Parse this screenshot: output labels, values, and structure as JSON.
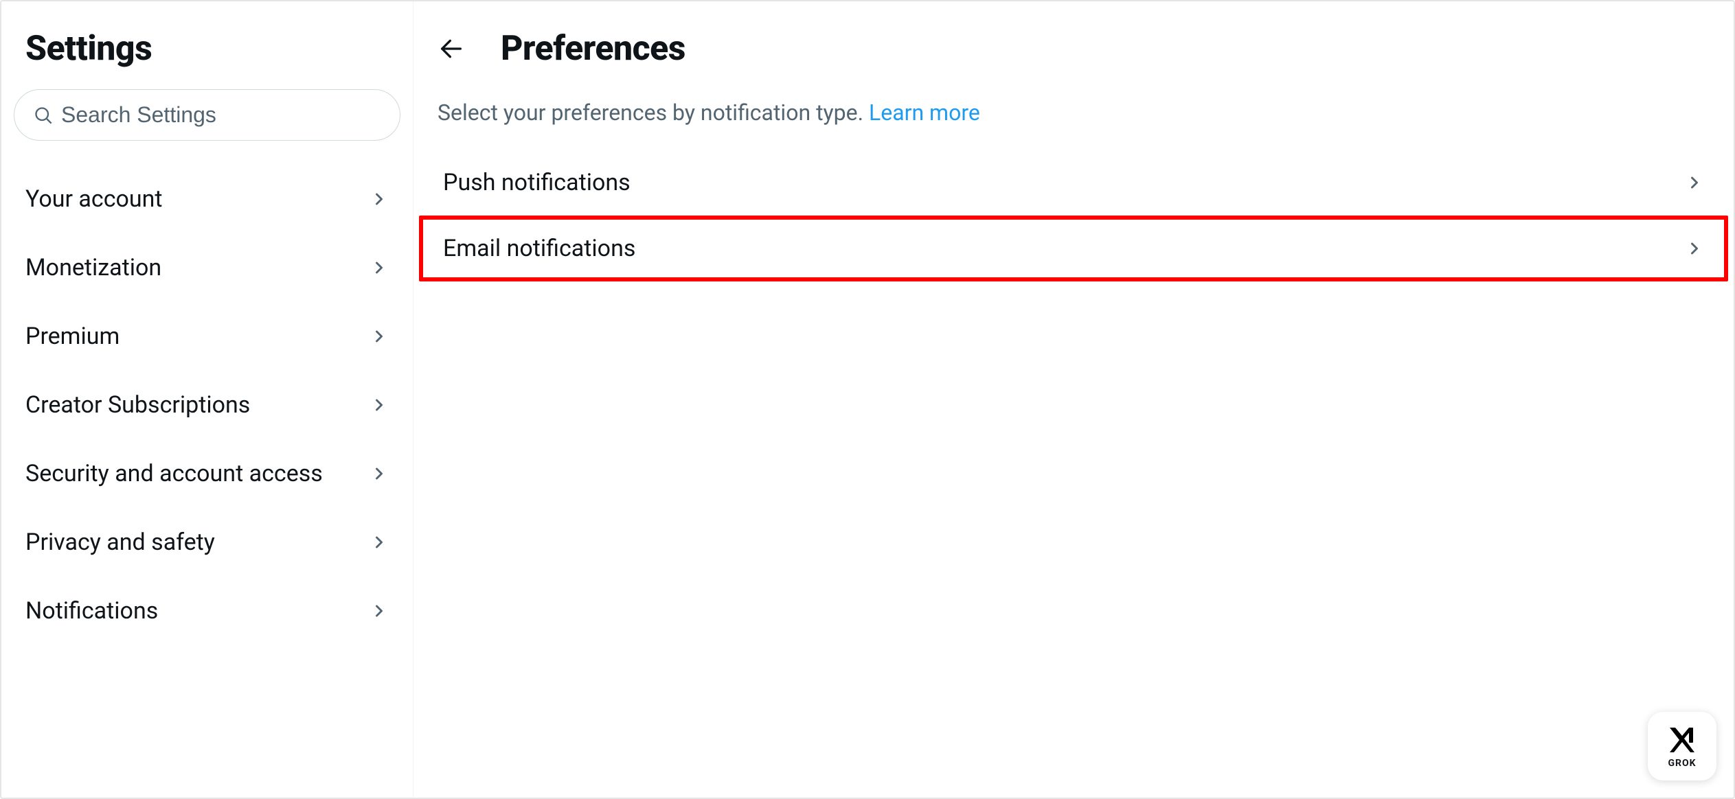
{
  "sidebar": {
    "title": "Settings",
    "search_placeholder": "Search Settings",
    "items": [
      {
        "label": "Your account"
      },
      {
        "label": "Monetization"
      },
      {
        "label": "Premium"
      },
      {
        "label": "Creator Subscriptions"
      },
      {
        "label": "Security and account access"
      },
      {
        "label": "Privacy and safety"
      },
      {
        "label": "Notifications"
      }
    ]
  },
  "main": {
    "title": "Preferences",
    "description_text": "Select your preferences by notification type. ",
    "learn_more_label": "Learn more",
    "items": [
      {
        "label": "Push notifications",
        "highlighted": false
      },
      {
        "label": "Email notifications",
        "highlighted": true
      }
    ]
  },
  "grok": {
    "label": "GROK"
  }
}
